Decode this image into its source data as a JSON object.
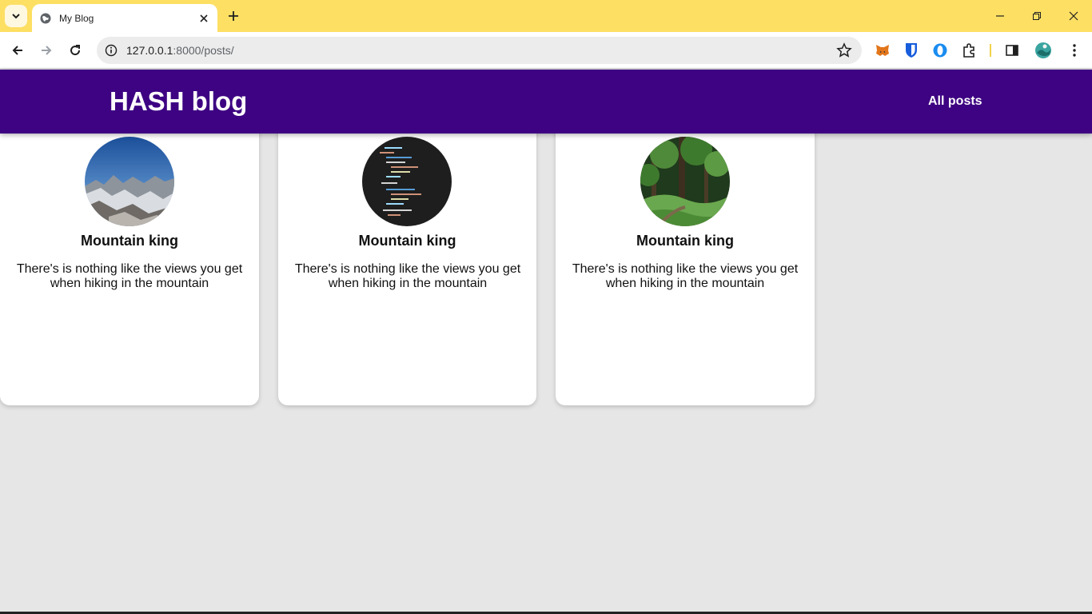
{
  "browser": {
    "tab_title": "My Blog",
    "url_host": "127.0.0.1",
    "url_path": ":8000/posts/"
  },
  "site": {
    "title": "HASH blog",
    "nav": {
      "all_posts": "All posts"
    },
    "colors": {
      "header": "#3d0382",
      "background": "#e6e6e6"
    }
  },
  "posts": [
    {
      "title": "Mountain king",
      "excerpt": "There's is nothing like the views you get when hiking in the mountain",
      "image": "mountain-photo"
    },
    {
      "title": "Mountain king",
      "excerpt": "There's is nothing like the views you get when hiking in the mountain",
      "image": "code-screenshot"
    },
    {
      "title": "Mountain king",
      "excerpt": "There's is nothing like the views you get when hiking in the mountain",
      "image": "forest-photo"
    }
  ]
}
